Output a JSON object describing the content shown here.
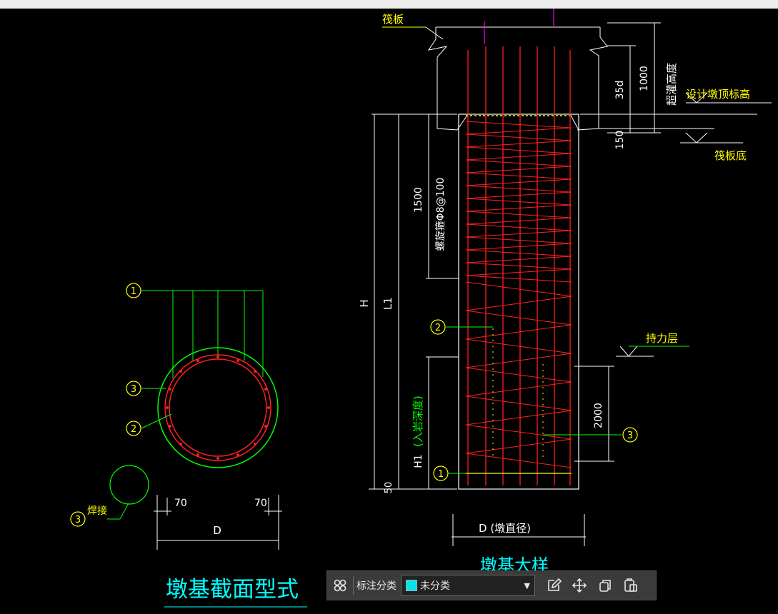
{
  "drawing": {
    "section_title": "墩基截面型式",
    "partial_title": "墩基大样",
    "labels": {
      "raft": "筏板",
      "super_pour": "超灌高度",
      "design_top": "设计墩顶标高",
      "raft_bottom": "筏板底",
      "spiral_hoop": "螺旋箍Φ8@100",
      "bearing_layer": "持力层",
      "rock_depth": "(入岩深度)",
      "weld": "焊接",
      "dim_1000": "1000",
      "dim_35d": "35d",
      "dim_150": "150",
      "dim_1500": "1500",
      "dim_2000": "2000",
      "dim_50": "50",
      "dim_70_left": "70",
      "dim_70_right": "70",
      "dim_D": "D",
      "dim_D_pier": "D (墩直径)",
      "h": "H",
      "l1": "L1",
      "h1": "H1"
    },
    "markers": {
      "m1": "1",
      "m2": "2",
      "m3": "3"
    },
    "colors": {
      "rebar": "#ff2020",
      "outline": "#00ff00",
      "text": "#ffff00",
      "accent": "#00ffff",
      "dim": "#ffffff",
      "magenta": "#ff00ff"
    }
  },
  "toolbar": {
    "group_icon": "grid-icon",
    "category_label": "标注分类",
    "category_value": "未分类",
    "category_color": "#00e5ee",
    "edit_icon": "edit-icon",
    "move_icon": "move-icon",
    "copy_icon": "copy-icon",
    "paste_icon": "paste-icon"
  }
}
